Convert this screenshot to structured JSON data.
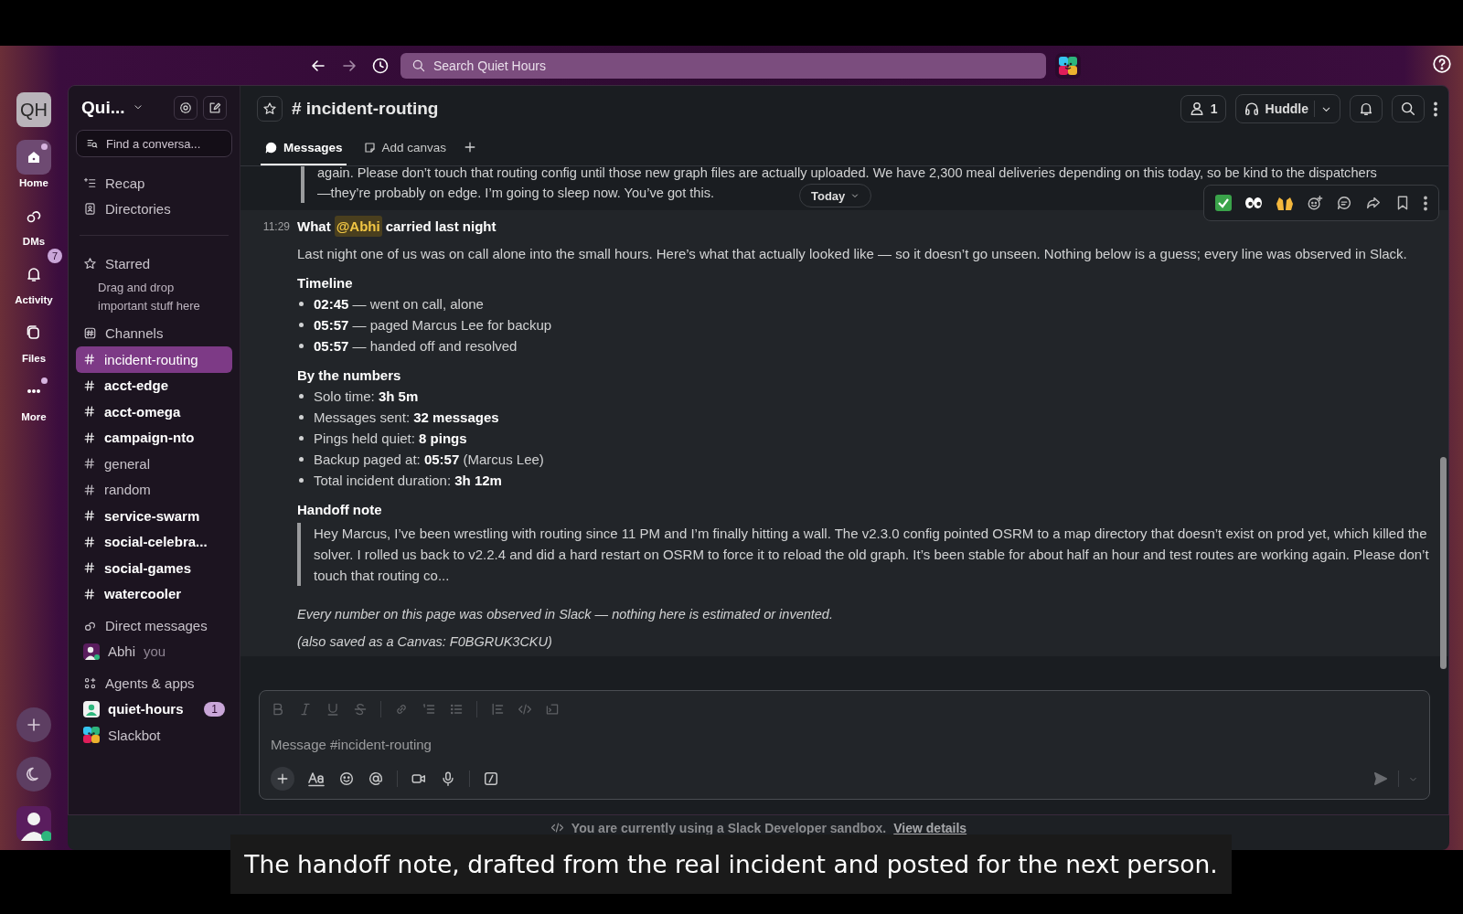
{
  "topbar": {
    "search": {
      "placeholder": "Search Quiet Hours"
    }
  },
  "rail": {
    "workspace": "QH",
    "items": [
      {
        "label": "Home",
        "selected": true,
        "dot": true
      },
      {
        "label": "DMs",
        "selected": false,
        "dot": false
      },
      {
        "label": "Activity",
        "selected": false,
        "dot": false,
        "badge": "7"
      },
      {
        "label": "Files",
        "selected": false,
        "dot": false
      },
      {
        "label": "More",
        "selected": false,
        "dot": true
      }
    ]
  },
  "sidebar": {
    "workspace_name": "Qui...",
    "find": {
      "placeholder": "Find a conversa..."
    },
    "nav": [
      "Recap",
      "Directories"
    ],
    "starred": {
      "title": "Starred",
      "hint": "Drag and drop important stuff here"
    },
    "channels_title": "Channels",
    "channels": [
      {
        "name": "incident-routing",
        "selected": true,
        "unread": false
      },
      {
        "name": "acct-edge",
        "selected": false,
        "unread": true
      },
      {
        "name": "acct-omega",
        "selected": false,
        "unread": true
      },
      {
        "name": "campaign-nto",
        "selected": false,
        "unread": true
      },
      {
        "name": "general",
        "selected": false,
        "unread": false
      },
      {
        "name": "random",
        "selected": false,
        "unread": false
      },
      {
        "name": "service-swarm",
        "selected": false,
        "unread": true
      },
      {
        "name": "social-celebra...",
        "selected": false,
        "unread": true
      },
      {
        "name": "social-games",
        "selected": false,
        "unread": true
      },
      {
        "name": "watercooler",
        "selected": false,
        "unread": true
      }
    ],
    "dm_title": "Direct messages",
    "dms": [
      {
        "name": "Abhi",
        "note": "you"
      }
    ],
    "apps_title": "Agents & apps",
    "apps": [
      {
        "name": "quiet-hours",
        "unread": true,
        "badge": "1",
        "kind": "app"
      },
      {
        "name": "Slackbot",
        "unread": false,
        "kind": "bot"
      }
    ]
  },
  "channel": {
    "name": "# incident-routing",
    "members": "1",
    "huddle": "Huddle",
    "tabs": [
      {
        "label": "Messages",
        "selected": true
      },
      {
        "label": "Add canvas",
        "selected": false
      }
    ]
  },
  "messages": {
    "quote_tail": [
      "again. Please don’t touch that routing config until those new graph files are actually uploaded. We have 2,300 meal deliveries depending on this today, so be kind to the dispatchers",
      "—they’re probably on edge. I’m going to sleep now. You’ve got this."
    ],
    "day_pill": "Today",
    "message": {
      "time": "11:29",
      "title_before": "What",
      "mention": "@Abhi",
      "title_after": "carried last night",
      "intro": "Last night one of us was on call alone into the small hours. Here’s what that actually looked like — so it doesn’t go unseen. Nothing below is a guess; every line was observed in Slack.",
      "sections": [
        {
          "heading": "Timeline",
          "bullets": [
            "**02:45** — went on call, alone",
            "**05:57** — paged Marcus Lee for backup",
            "**05:57** — handed off and resolved"
          ]
        },
        {
          "heading": "By the numbers",
          "bullets": [
            "Solo time: **3h 5m**",
            "Messages sent: **32 messages**",
            "Pings held quiet: **8 pings**",
            "Backup paged at: **05:57** (Marcus Lee)",
            "Total incident duration: **3h 12m**"
          ]
        }
      ],
      "handoff_heading": "Handoff note",
      "handoff_quote": "Hey Marcus, I’ve been wrestling with routing since 11 PM and I’m finally hitting a wall. The v2.3.0 config pointed OSRM to a map directory that doesn’t exist on prod yet, which killed the solver. I rolled us back to v2.2.4 and did a hard restart on OSRM to force it to reload the old graph. It’s been stable for about half an hour and test routes are working again. Please don’t touch that routing co...",
      "footer": [
        "Every number on this page was observed in Slack — nothing here is estimated or invented.",
        "(also saved as a Canvas: F0BGRUK3CKU)"
      ]
    }
  },
  "composer": {
    "placeholder": "Message #incident-routing"
  },
  "banner": {
    "text": "You are currently using a Slack Developer sandbox.",
    "link": "View details"
  },
  "caption": "The handoff note, drafted from the real incident and posted for the next person."
}
